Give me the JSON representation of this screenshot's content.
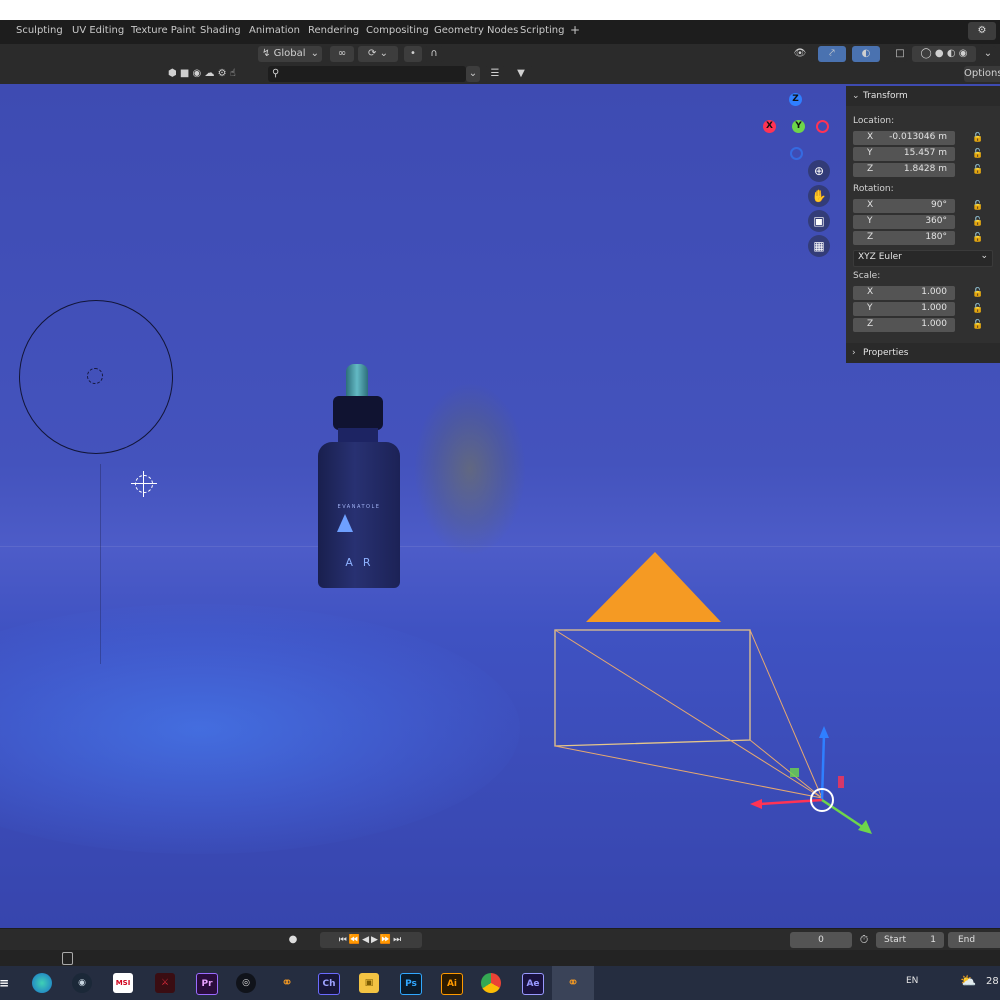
{
  "workspaces": [
    "Sculpting",
    "UV Editing",
    "Texture Paint",
    "Shading",
    "Animation",
    "Rendering",
    "Compositing",
    "Geometry Nodes",
    "Scripting",
    "+"
  ],
  "header": {
    "orientation": "Global",
    "options_label": "Options"
  },
  "bottle": {
    "brand": "EVANATOLE",
    "letters": "AR"
  },
  "gizmo": {
    "z": "Z",
    "x": "X",
    "y": "Y"
  },
  "transform": {
    "title": "Transform",
    "location_label": "Location:",
    "location": [
      {
        "axis": "X",
        "value": "-0.013046 m"
      },
      {
        "axis": "Y",
        "value": "15.457 m"
      },
      {
        "axis": "Z",
        "value": "1.8428 m"
      }
    ],
    "rotation_label": "Rotation:",
    "rotation": [
      {
        "axis": "X",
        "value": "90°"
      },
      {
        "axis": "Y",
        "value": "360°"
      },
      {
        "axis": "Z",
        "value": "180°"
      }
    ],
    "rotation_mode": "XYZ Euler",
    "scale_label": "Scale:",
    "scale": [
      {
        "axis": "X",
        "value": "1.000"
      },
      {
        "axis": "Y",
        "value": "1.000"
      },
      {
        "axis": "Z",
        "value": "1.000"
      }
    ]
  },
  "properties_label": "Properties",
  "timeline": {
    "current_frame": "0",
    "start_label": "Start",
    "start_value": "1",
    "end_label": "End"
  },
  "taskbar": {
    "icons": [
      "edge-icon",
      "steam-icon",
      "msi-icon",
      "game-icon",
      "premiere-icon",
      "cinema4d-icon",
      "blender-icon",
      "character-animator-icon",
      "file-explorer-icon",
      "photoshop-icon",
      "illustrator-icon",
      "chrome-icon",
      "after-effects-icon",
      "blender-active-icon"
    ],
    "labels": {
      "premiere": "Pr",
      "character": "Ch",
      "photoshop": "Ps",
      "illustrator": "Ai",
      "aftereffects": "Ae",
      "msi": "MSI"
    },
    "language": "EN",
    "temp": "28"
  },
  "colors": {
    "viewport": "#4453bd",
    "panel": "#303030",
    "camera_triangle": "#f59a23",
    "camera_frame": "#e6c68a"
  }
}
